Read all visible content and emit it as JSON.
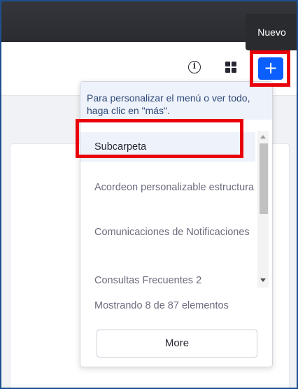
{
  "tooltip": {
    "text": "Nuevo"
  },
  "toolbar": {
    "info_icon": "info-icon",
    "apps_icon": "grid-icon",
    "add_icon": "plus-icon",
    "add_glyph": "+",
    "info_glyph": "i"
  },
  "dropdown": {
    "help_text": "Para personalizar el menú o ver todo, haga clic en \"más\".",
    "items": [
      {
        "label": "Subcarpeta"
      },
      {
        "label": "Acordeon personalizable estructura"
      },
      {
        "label": "Comunicaciones de Notificaciones"
      },
      {
        "label": "Consultas Frecuentes 2"
      }
    ],
    "status": "Mostrando 8 de 87 elementos",
    "more_label": "More"
  },
  "colors": {
    "accent": "#0b5fff",
    "highlight": "#e8000b",
    "topbar": "#2a2c31"
  }
}
